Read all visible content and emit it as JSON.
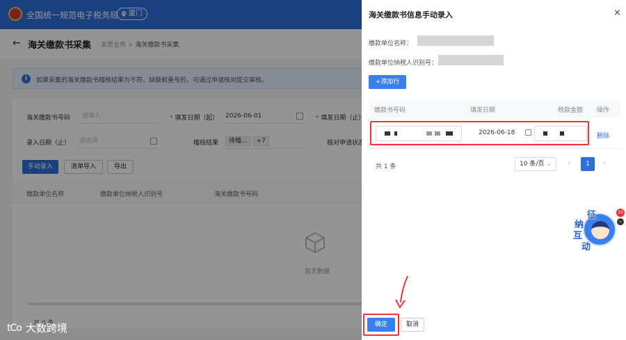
{
  "header": {
    "site_title": "全国统一规范电子税务局",
    "city": "厦门"
  },
  "page": {
    "title": "海关缴款书采集",
    "breadcrumb_parent": "发票业务",
    "breadcrumb_sep": ">",
    "breadcrumb_current": "海关缴款书采集"
  },
  "notice": {
    "text": "如果采集的海关缴款书稽核结果为不符、缺联和重号的，可通过申请核对提交审核。"
  },
  "filters": {
    "customs_no_label": "海关缴款书号码",
    "customs_no_placeholder": "请输入",
    "fill_date_start_label": "填发日期（起）",
    "fill_date_start_value": "2026-06-01",
    "fill_date_end_label": "填发日期（止）",
    "entry_date_end_label": "录入日期（止）",
    "entry_date_placeholder": "请选择",
    "audit_result_label": "稽核结果",
    "audit_result_chip": "待稽...",
    "audit_result_more": "+7",
    "check_apply_label": "核对申请状态"
  },
  "actions": {
    "manual_entry": "手动录入",
    "list_import": "清单导入",
    "export": "导出"
  },
  "bg_table": {
    "columns": [
      "缴款单位名称",
      "缴款单位纳税人识别号",
      "海关缴款书号码"
    ],
    "empty_text": "暂无数据",
    "total": "共 0 条"
  },
  "drawer": {
    "title": "海关缴款书信息手动录入",
    "close": "×",
    "payer_name_label": "缴款单位名称：",
    "payer_tax_id_label": "缴款单位纳税人识别号：",
    "add_row": "+添加行",
    "columns": [
      "缴款书号码",
      "填发日期",
      "税款金额",
      "操作"
    ],
    "rows": [
      {
        "date": "2026-06-18",
        "action": "删除"
      }
    ],
    "total": "共 1 条",
    "page_size": "10 条/页",
    "current_page": "1",
    "confirm": "确定",
    "cancel": "取消"
  },
  "assistant": {
    "chars": [
      "征",
      "纳",
      "互",
      "动"
    ],
    "badge": "10"
  },
  "watermark": {
    "logo": "tCo",
    "text": "大数跨境"
  },
  "colors": {
    "brand_blue": "#2d6fdc",
    "highlight_red": "#e33333"
  }
}
